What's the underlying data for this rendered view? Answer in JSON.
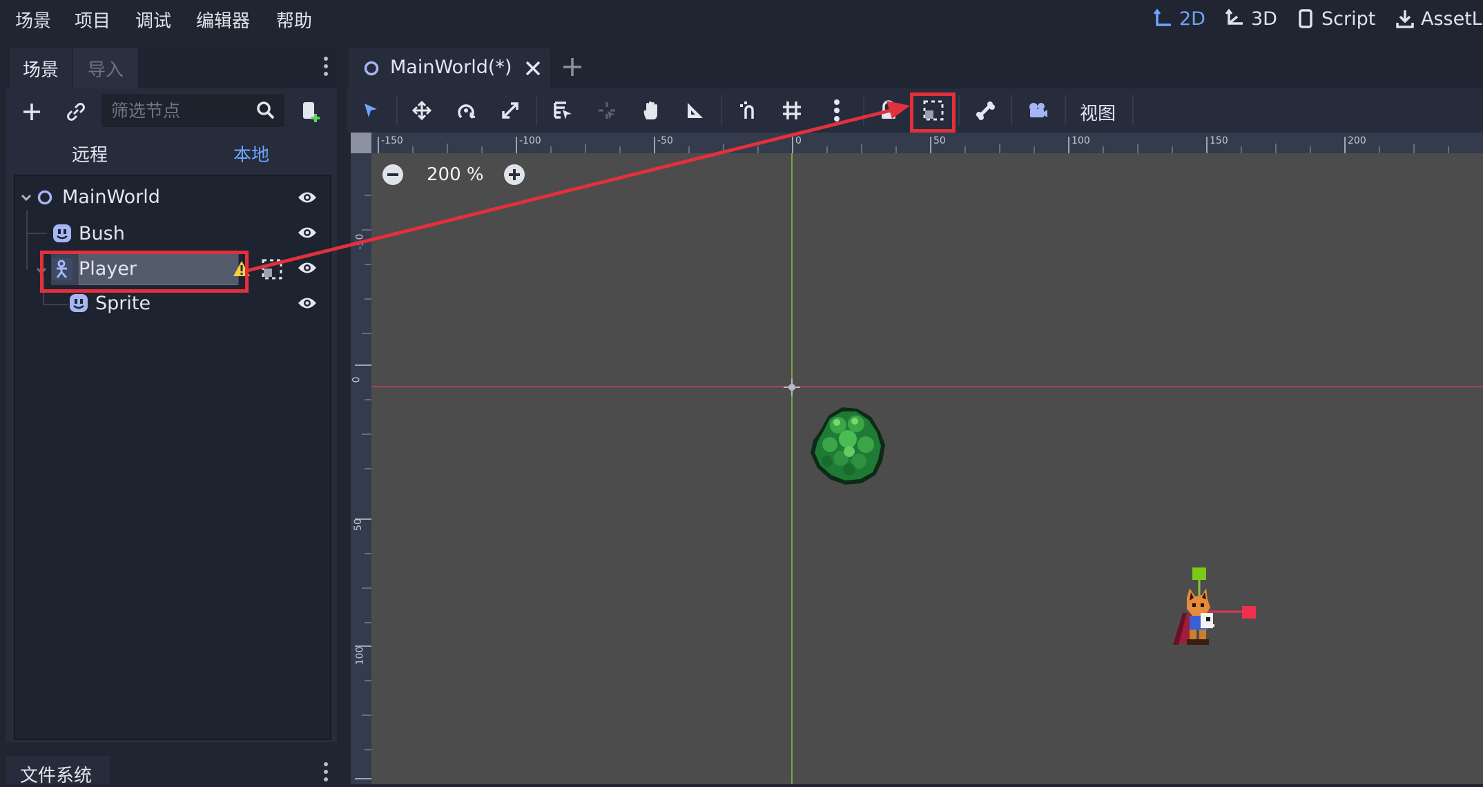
{
  "menu": {
    "items": [
      "场景",
      "项目",
      "调试",
      "编辑器",
      "帮助"
    ],
    "workspaces": [
      "2D",
      "3D",
      "Script",
      "AssetLib"
    ],
    "active_workspace": "2D"
  },
  "scene_dock": {
    "tabs": [
      "场景",
      "导入"
    ],
    "active_tab": "场景",
    "filter_placeholder": "筛选节点",
    "remote_label": "远程",
    "local_label": "本地",
    "tree": [
      {
        "name": "MainWorld",
        "icon": "node2d-circle-icon",
        "depth": 0,
        "expanded": true
      },
      {
        "name": "Bush",
        "icon": "sprite-face-icon",
        "depth": 1
      },
      {
        "name": "Player",
        "icon": "kinematic-body-icon",
        "depth": 1,
        "expanded": true,
        "selected": true,
        "editing": true,
        "warning": true
      },
      {
        "name": "Sprite",
        "icon": "sprite-face-icon",
        "depth": 2
      }
    ]
  },
  "filesystem_dock": {
    "tab_label": "文件系统"
  },
  "editor": {
    "scene_tab_title": "MainWorld(*)",
    "view_menu_label": "视图",
    "zoom_label": "200 %",
    "ruler_h_labels": [
      "-150",
      "-100",
      "-50",
      "0",
      "50",
      "100",
      "150",
      "200"
    ],
    "ruler_v_labels": [
      "-50",
      "0",
      "50",
      "100"
    ]
  },
  "colors": {
    "accent": "#6fa5ff",
    "annotation_red": "#e3303d",
    "viewport_bg": "#4c4c4c",
    "y_axis": "#8fbf3c",
    "x_axis": "#c0405a",
    "warning": "#f5d142"
  }
}
